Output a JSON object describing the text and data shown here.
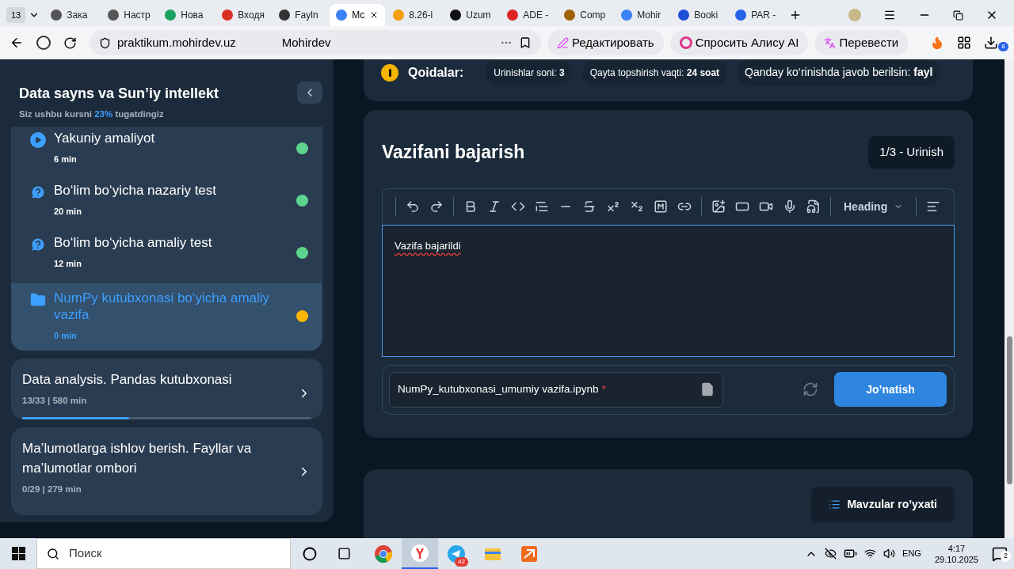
{
  "browser": {
    "tab_count": "13",
    "tabs": [
      {
        "title": "Зака",
        "selected": false
      },
      {
        "title": "Настр",
        "selected": false
      },
      {
        "title": "Нова",
        "selected": false
      },
      {
        "title": "Входя",
        "selected": false
      },
      {
        "title": "Fayln",
        "selected": false
      },
      {
        "title": "Mc",
        "selected": true
      },
      {
        "title": "8.26-l",
        "selected": false
      },
      {
        "title": "Uzum",
        "selected": false
      },
      {
        "title": "ADE -",
        "selected": false
      },
      {
        "title": "Comp",
        "selected": false
      },
      {
        "title": "Mohir",
        "selected": false
      },
      {
        "title": "Booki",
        "selected": false
      },
      {
        "title": "PAR -",
        "selected": false
      }
    ],
    "address": {
      "url": "praktikum.mohirdev.uz",
      "page_title": "Mohirdev"
    },
    "actions": [
      "Редактировать",
      "Спросить Алису AI",
      "Перевести"
    ],
    "downloads_badge": "8"
  },
  "sidebar": {
    "course_title": "Data sayns va Sun’iy intellekt",
    "progress_prefix": "Siz ushbu kursni",
    "progress_percent": "23%",
    "progress_suffix": "tugatdingiz",
    "lessons": [
      {
        "kind": "video",
        "title": "Yakuniy amaliyot",
        "duration": "6 min",
        "color": "#5dd48e",
        "selected": false
      },
      {
        "kind": "test",
        "title": "Bo‘lim bo‘yicha nazariy test",
        "duration": "20 min",
        "color": "#5dd48e",
        "selected": false
      },
      {
        "kind": "test",
        "title": "Bo‘lim bo‘yicha amaliy test",
        "duration": "12 min",
        "color": "#5dd48e",
        "selected": false
      },
      {
        "kind": "task",
        "title": "NumPy kutubxonasi bo‘yicha amaliy vazifa",
        "duration": "0 min",
        "color": "#f7b500",
        "selected": true
      }
    ],
    "modules": [
      {
        "title": "Data analysis. Pandas kutubxonasi",
        "meta": "13/33 | 580 min",
        "level": 0.37
      },
      {
        "title": "Ma’lumotlarga ishlov berish. Fayllar va ma’lumotlar ombori",
        "meta": "0/29 | 279 min"
      }
    ]
  },
  "rules": {
    "label": "Qoidalar:",
    "items": [
      {
        "name": "Urinishlar soni:",
        "value": "3"
      },
      {
        "name": "Qayta topshirish vaqti:",
        "value": "24 soat"
      },
      {
        "name": "Qanday ko‘rinishda javob berilsin:",
        "value": "fayl"
      }
    ]
  },
  "task": {
    "title": "Vazifani bajarish",
    "attempt": "1/3 - Urinish",
    "heading_select": "Heading",
    "answer": "Vazifa bajarildi",
    "file_name": "NumPy_kutubxonasi_umumiy vazifa.ipynb",
    "required_mark": "*",
    "submit": "Jo’natish"
  },
  "footer": {
    "topics_button": "Mavzular ro’yxati"
  },
  "taskbar": {
    "search_placeholder": "Поиск",
    "apps": [
      {
        "selected": false
      },
      {
        "selected": true
      },
      {
        "selected": false,
        "badge": "42"
      },
      {
        "selected": false
      },
      {
        "selected": false
      }
    ],
    "language": "ENG",
    "time": "4:17",
    "date": "29.10.2025",
    "notifications": "2"
  }
}
